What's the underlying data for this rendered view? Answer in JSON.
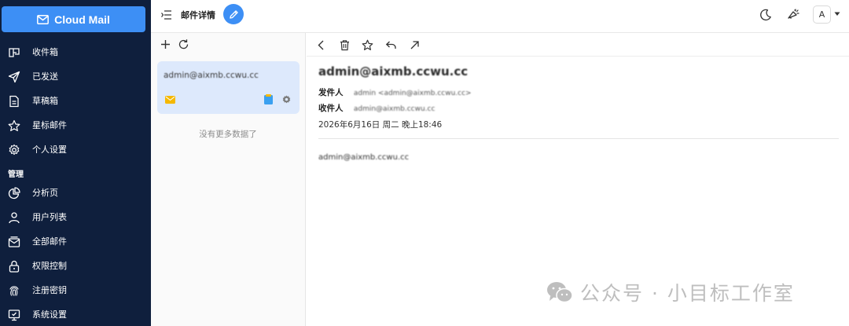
{
  "app": {
    "brand_label": "Cloud Mail"
  },
  "sidebar": {
    "items": [
      {
        "label": "收件箱",
        "icon": "inbox-icon"
      },
      {
        "label": "已发送",
        "icon": "send-icon"
      },
      {
        "label": "草稿箱",
        "icon": "draft-icon"
      },
      {
        "label": "星标邮件",
        "icon": "star-icon"
      },
      {
        "label": "个人设置",
        "icon": "gear-icon"
      }
    ],
    "admin_section_label": "管理",
    "admin_items": [
      {
        "label": "分析页",
        "icon": "pie-chart-icon"
      },
      {
        "label": "用户列表",
        "icon": "user-icon"
      },
      {
        "label": "全部邮件",
        "icon": "mail-stack-icon"
      },
      {
        "label": "权限控制",
        "icon": "lock-icon"
      },
      {
        "label": "注册密钥",
        "icon": "fingerprint-icon"
      },
      {
        "label": "系统设置",
        "icon": "monitor-settings-icon"
      }
    ]
  },
  "topbar": {
    "title": "邮件详情",
    "avatar_letter": "A"
  },
  "mail_list": {
    "items": [
      {
        "sender": "admin@aixmb.ccwu.cc",
        "selected": true
      }
    ],
    "empty_hint": "没有更多数据了"
  },
  "detail": {
    "subject": "admin@aixmb.ccwu.cc",
    "from_label": "发件人",
    "from_value": "admin <admin@aixmb.ccwu.cc>",
    "to_label": "收件人",
    "to_value": "admin@aixmb.ccwu.cc",
    "date": "2026年6月16日 周二 晚上18:46",
    "body": "admin@aixmb.ccwu.cc"
  },
  "watermark": {
    "text": "公众号 · 小目标工作室"
  },
  "colors": {
    "sidebar_bg": "#0f1f3d",
    "accent": "#3d8ff5",
    "selected_card": "#dde9fc",
    "envelope_yellow": "#f5b800",
    "tag_blue": "#3aa0f0"
  }
}
